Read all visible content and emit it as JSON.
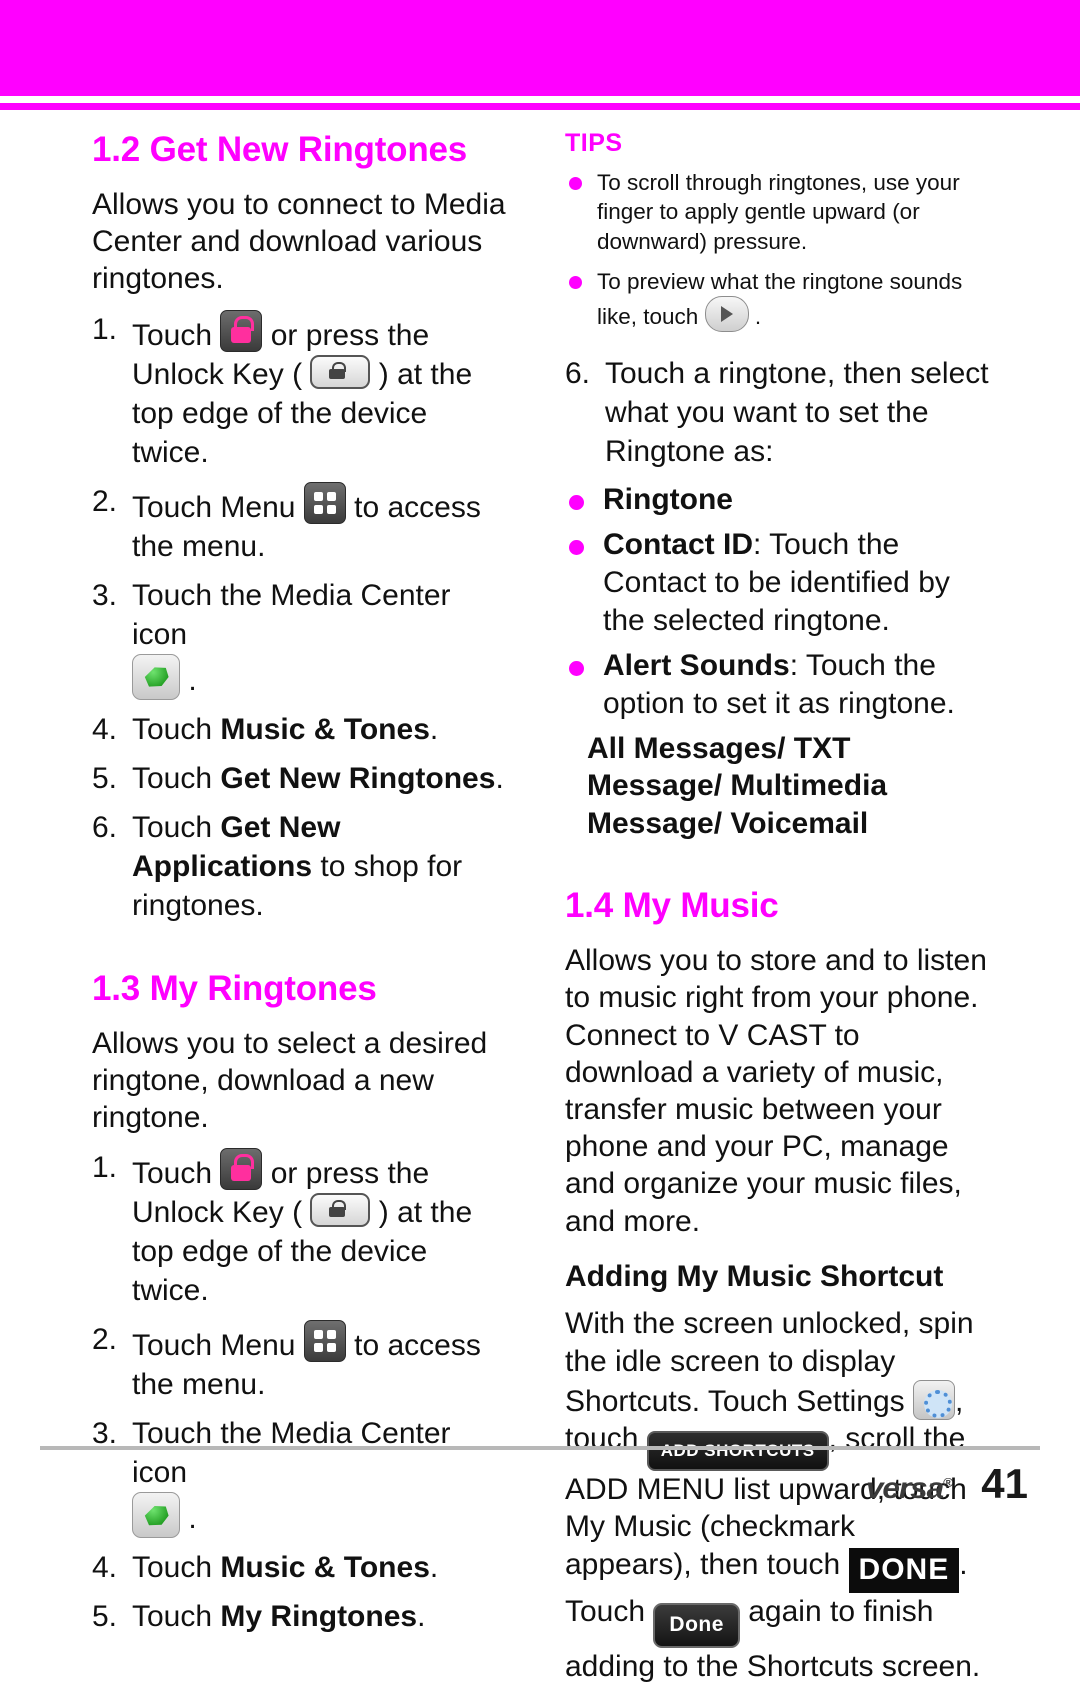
{
  "header": {
    "band_color": "#ff00ff"
  },
  "left_column": {
    "section_12": {
      "title": "1.2 Get New Ringtones",
      "intro": "Allows you to connect to Media Center and download various ringtones.",
      "steps": [
        {
          "num": "1.",
          "pre": "Touch",
          "icon1": "lock-icon",
          "mid": "or press the Unlock Key (",
          "icon2": "unlock-key-icon",
          "post": ") at the top edge of the device twice."
        },
        {
          "num": "2.",
          "pre": "Touch Menu",
          "icon1": "menu-icon",
          "post": "to access the menu."
        },
        {
          "num": "3.",
          "pre": "Touch the Media Center icon",
          "icon1": "media-center-icon",
          "post": "."
        },
        {
          "num": "4.",
          "pre": "Touch",
          "bold": "Music & Tones",
          "post": "."
        },
        {
          "num": "5.",
          "pre": "Touch",
          "bold": "Get New Ringtones",
          "post": "."
        },
        {
          "num": "6.",
          "pre": "Touch",
          "bold": "Get New Applications",
          "post": "to shop for ringtones."
        }
      ]
    },
    "section_13": {
      "title": "1.3 My Ringtones",
      "intro": "Allows you to select a desired ringtone, download a new ringtone.",
      "steps": [
        {
          "num": "1.",
          "pre": "Touch",
          "icon1": "lock-icon",
          "mid": "or press the Unlock Key (",
          "icon2": "unlock-key-icon",
          "post": ") at the top edge of the device twice."
        },
        {
          "num": "2.",
          "pre": "Touch Menu",
          "icon1": "menu-icon",
          "post": "to access the menu."
        },
        {
          "num": "3.",
          "pre": "Touch the Media Center icon",
          "icon1": "media-center-icon",
          "post": "."
        },
        {
          "num": "4.",
          "pre": "Touch",
          "bold": "Music & Tones",
          "post": "."
        },
        {
          "num": "5.",
          "pre": "Touch",
          "bold": "My Ringtones",
          "post": "."
        }
      ]
    }
  },
  "right_column": {
    "tips": {
      "title": "TIPS",
      "items": [
        {
          "text": "To scroll through ringtones, use your finger to apply gentle upward (or downward) pressure."
        },
        {
          "text_pre": "To preview what the ringtone sounds like, touch",
          "icon": "play-icon",
          "text_post": "."
        }
      ]
    },
    "step6": {
      "num": "6.",
      "text": "Touch a ringtone, then select what you want to set the Ringtone as:"
    },
    "options": [
      {
        "label": "Ringtone",
        "desc": ""
      },
      {
        "label": "Contact ID",
        "desc": ": Touch the Contact to be identified by the selected ringtone."
      },
      {
        "label": "Alert Sounds",
        "desc": ": Touch the option to set it as ringtone."
      }
    ],
    "all_messages": "All Messages/ TXT Message/ Multimedia Message/ Voicemail",
    "section_14": {
      "title": "1.4 My Music",
      "intro": "Allows you to store and to listen to music right from your phone. Connect to V CAST to download a variety of music, transfer music between your phone and your PC, manage and organize your music files, and more.",
      "subheading": "Adding My Music Shortcut",
      "shortcut_p1": "With the screen unlocked, spin the idle screen to display Shortcuts. Touch Settings",
      "shortcut_p2": ", touch",
      "add_shortcuts_label": "ADD SHORTCUTS",
      "shortcut_p3": ", scroll the ADD MENU list upward, touch My Music (checkmark appears), then touch",
      "done_big_label": "DONE",
      "shortcut_p4": ". Touch",
      "done_small_label": "Done",
      "shortcut_p5": "again to finish adding to the Shortcuts screen."
    }
  },
  "footer": {
    "logo": "versa",
    "logo_mark": "®",
    "page_number": "41"
  }
}
